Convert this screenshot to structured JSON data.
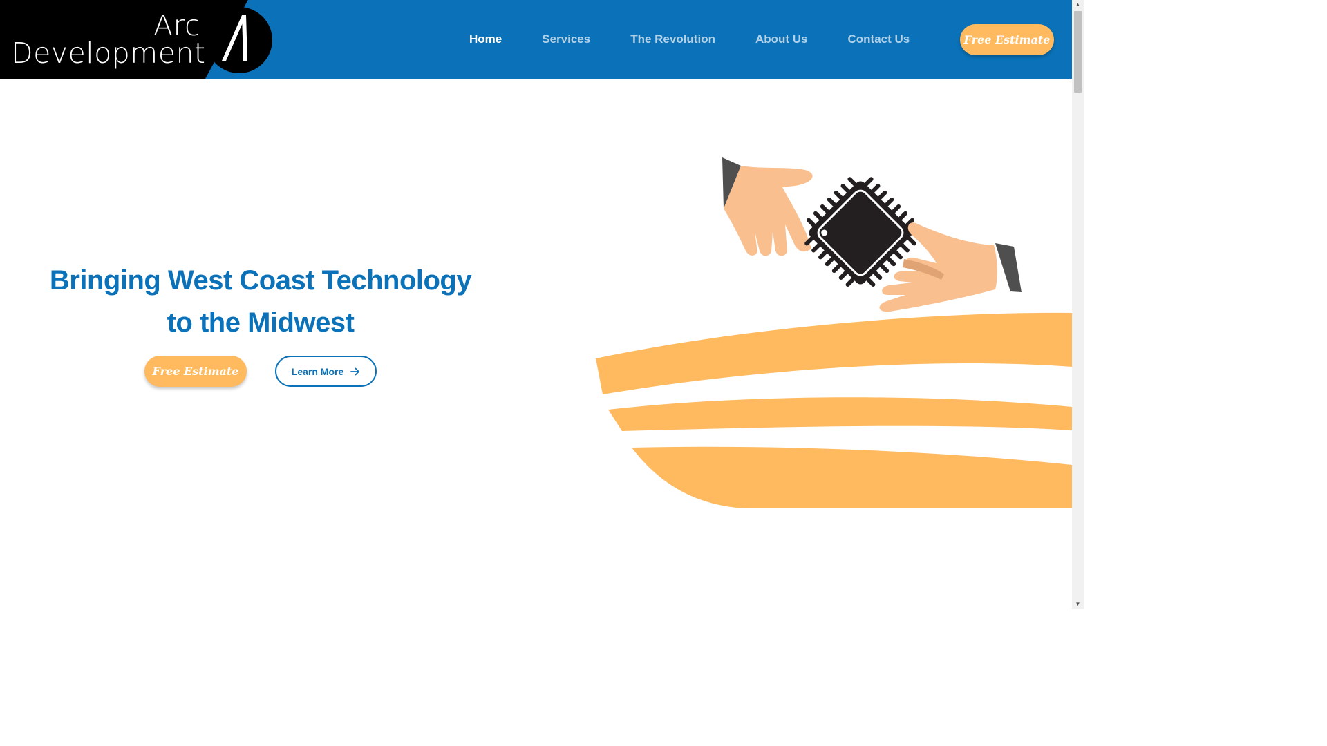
{
  "header": {
    "logo": {
      "line1": "Arc",
      "line2": "Development"
    },
    "tabs": [
      {
        "label": "Home",
        "active": true
      },
      {
        "label": "Services",
        "active": false
      },
      {
        "label": "The Revolution",
        "active": false
      },
      {
        "label": "About Us",
        "active": false
      },
      {
        "label": "Contact Us",
        "active": false
      }
    ],
    "estimate_label": "Free Estimate"
  },
  "hero": {
    "title_line1": "Bringing West Coast Technology",
    "title_line2": "to the Midwest",
    "estimate_label": "Free Estimate",
    "learn_more_label": "Learn More"
  },
  "colors": {
    "primary_blue": "#0b72b9",
    "accent_orange": "#ffba60",
    "logo_black": "#000000",
    "skin_tone": "#f9bf8f",
    "sleeve_gray": "#4f4f4f"
  },
  "icons": {
    "learn_more": "arrow-right-icon",
    "hero_image": "hands-exchanging-chip-illustration"
  }
}
